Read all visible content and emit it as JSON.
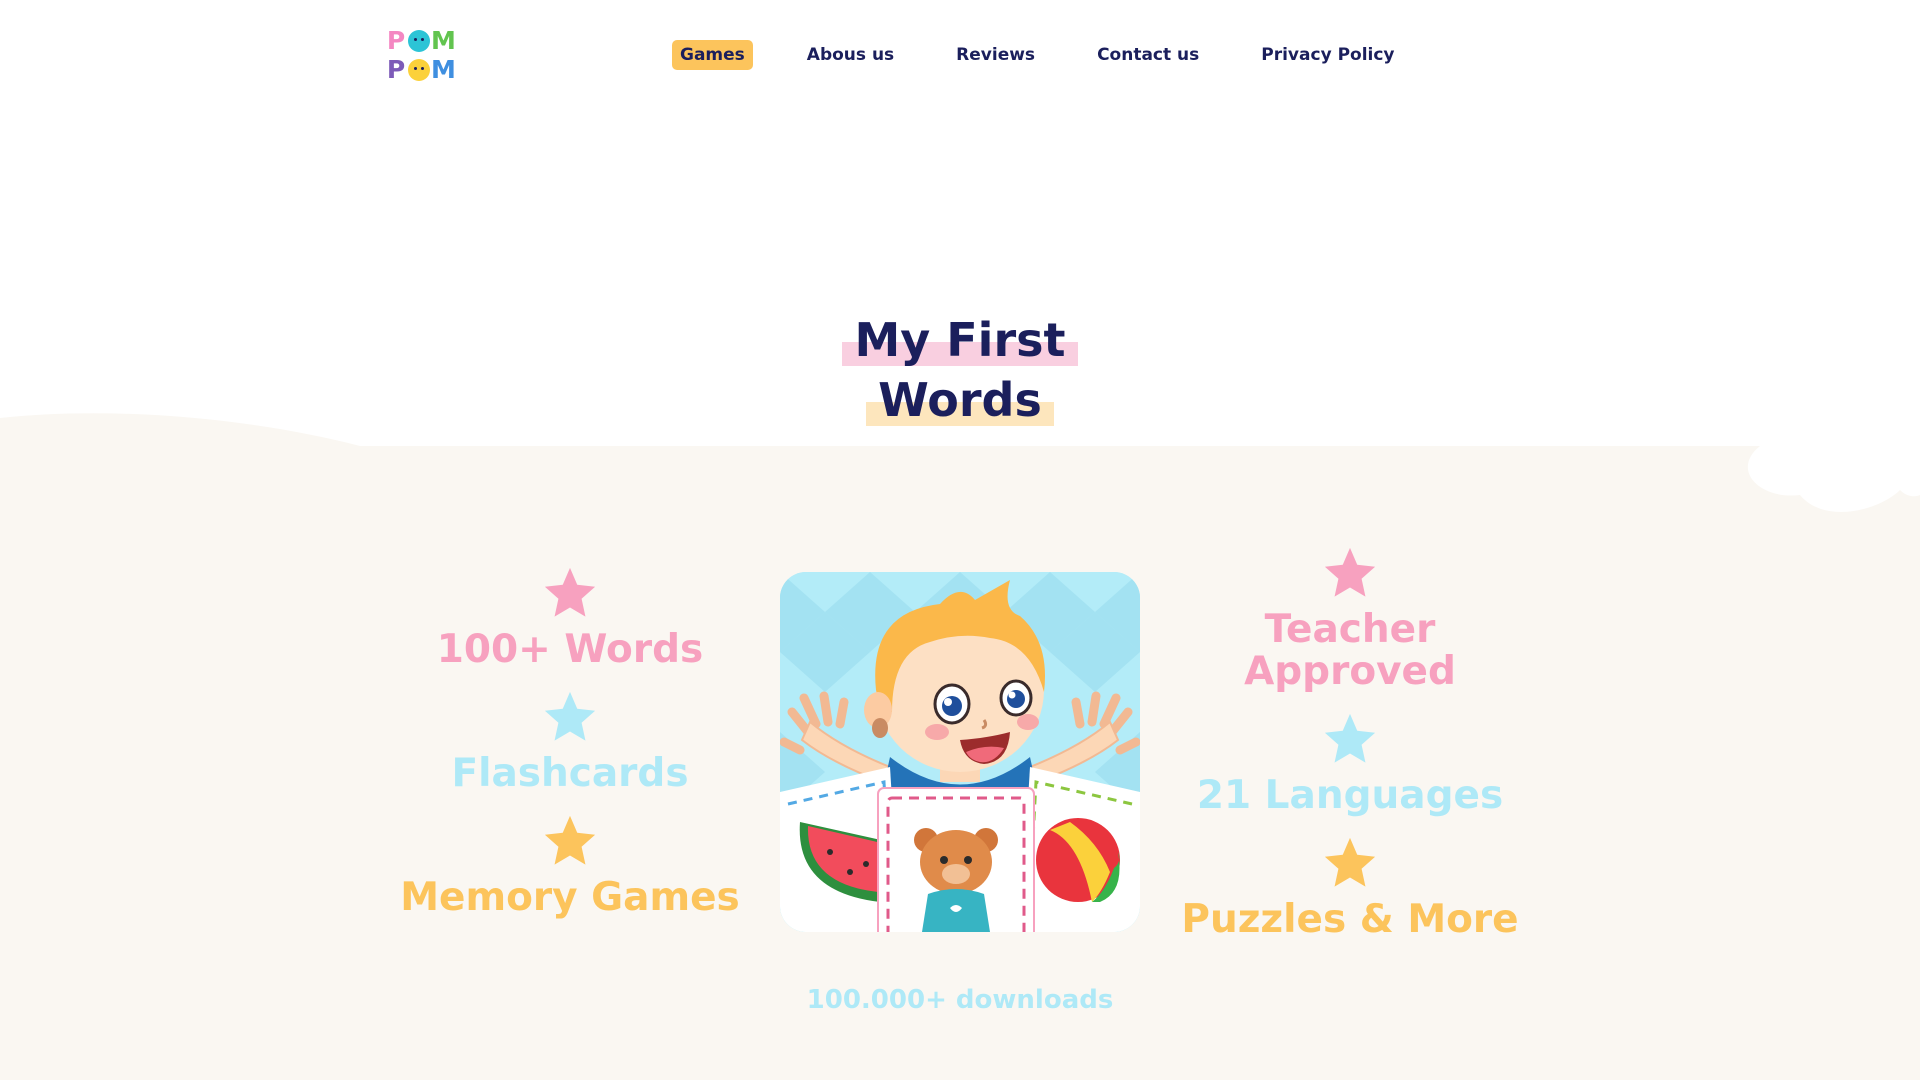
{
  "logo": {
    "rows": [
      [
        {
          "char": "P",
          "color": "#f487c2"
        },
        {
          "face": true,
          "color": "#2cc4d6"
        },
        {
          "char": "M",
          "color": "#62c44f"
        }
      ],
      [
        {
          "char": "P",
          "color": "#7d5bb8"
        },
        {
          "face": true,
          "color": "#fbd13b"
        },
        {
          "char": "M",
          "color": "#3f8fe0"
        }
      ]
    ]
  },
  "nav": {
    "items": [
      {
        "label": "Games",
        "active": true
      },
      {
        "label": "Abous us",
        "active": false
      },
      {
        "label": "Reviews",
        "active": false
      },
      {
        "label": "Contact us",
        "active": false
      },
      {
        "label": "Privacy Policy",
        "active": false
      }
    ]
  },
  "hero": {
    "title_line1": "My First",
    "title_line2": "Words"
  },
  "features": {
    "left": [
      {
        "label": "100+ Words",
        "color": "pink",
        "star_color": "#f7a1bf"
      },
      {
        "label": "Flashcards",
        "color": "blue",
        "star_color": "#aee9f7"
      },
      {
        "label": "Memory Games",
        "color": "yellow",
        "star_color": "#fcc45c"
      }
    ],
    "right": [
      {
        "label": "Teacher\nApproved",
        "color": "pink",
        "star_color": "#f7a1bf"
      },
      {
        "label": "21 Languages",
        "color": "blue",
        "star_color": "#aee9f7"
      },
      {
        "label": "Puzzles & More",
        "color": "yellow",
        "star_color": "#fcc45c"
      }
    ]
  },
  "downloads": "100.000+ downloads",
  "colors": {
    "navy": "#1b1f5c",
    "accent_yellow": "#fcc45c",
    "pink": "#f7a1bf",
    "blue": "#aee9f7",
    "cream": "#faf7f2"
  }
}
